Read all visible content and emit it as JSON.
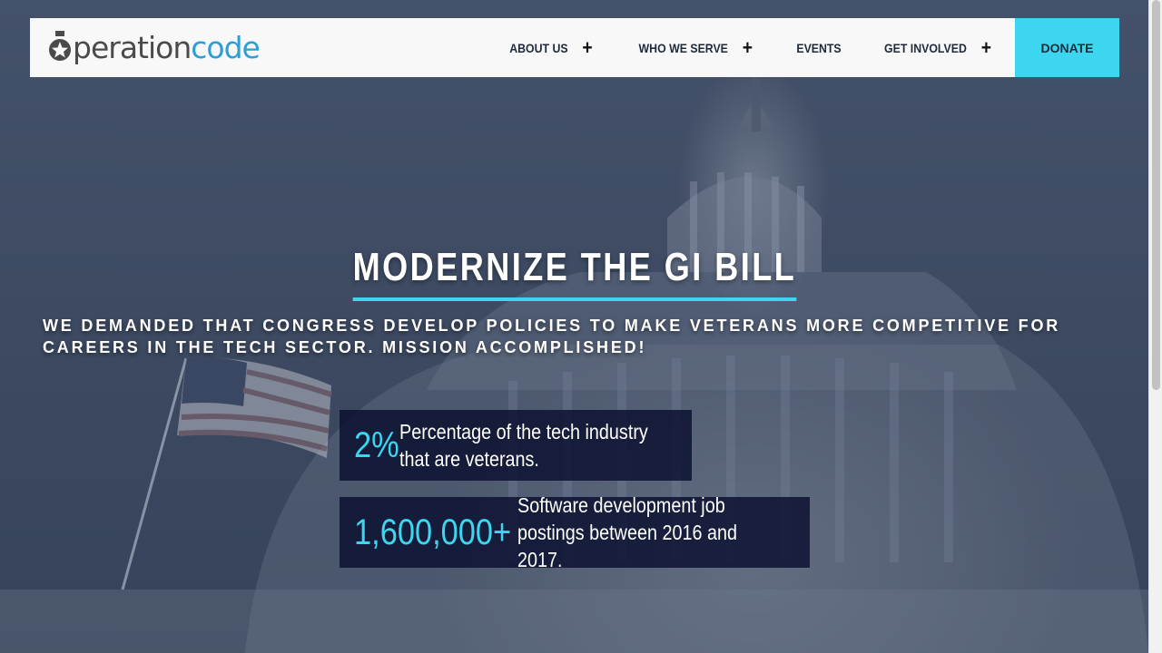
{
  "brand": {
    "logo_part_1": "peration",
    "logo_part_2": "code",
    "accent_color": "#3dd6f0",
    "logo_color": "#2b9ed6"
  },
  "nav": {
    "items": [
      {
        "label": "ABOUT US",
        "has_submenu": true
      },
      {
        "label": "WHO WE SERVE",
        "has_submenu": true
      },
      {
        "label": "EVENTS",
        "has_submenu": false
      },
      {
        "label": "GET INVOLVED",
        "has_submenu": true
      }
    ],
    "submenu_icon": "plus-icon",
    "donate_label": "DONATE"
  },
  "hero": {
    "title": "MODERNIZE THE GI BILL",
    "subtitle": "WE DEMANDED THAT CONGRESS DEVELOP POLICIES TO MAKE VETERANS MORE COMPETITIVE FOR CAREERS IN THE TECH SECTOR. MISSION ACCOMPLISHED!",
    "stats": [
      {
        "value": "2%",
        "description": "Percentage of the tech industry that are veterans."
      },
      {
        "value": "1,600,000+",
        "description": "Software development job postings between 2016 and 2017."
      }
    ]
  }
}
